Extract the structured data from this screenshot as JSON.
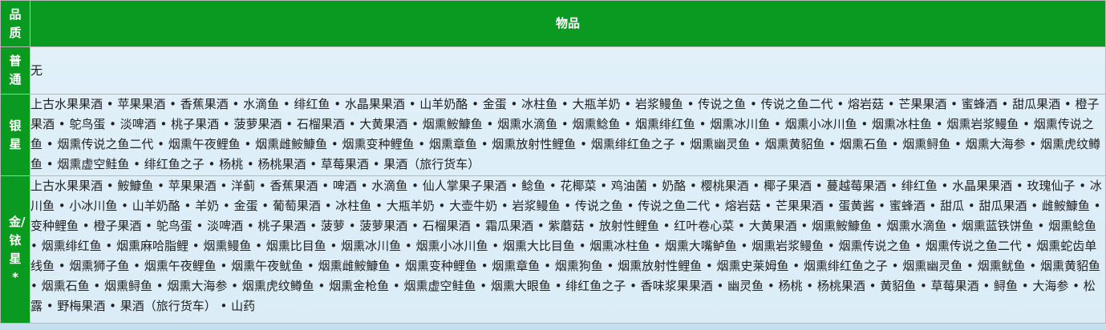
{
  "header": {
    "quality": "品质",
    "items": "物品"
  },
  "rows": [
    {
      "quality": "普通",
      "items": "无"
    },
    {
      "quality": "银星",
      "items": "上古水果果酒 • 苹果果酒 • 香蕉果酒 • 水滴鱼 • 绯红鱼 • 水晶果果酒 • 山羊奶酪 • 金蛋 • 冰柱鱼 • 大瓶羊奶 • 岩浆鳗鱼 • 传说之鱼 • 传说之鱼二代 • 熔岩菇 • 芒果果酒 • 蜜蜂酒 • 甜瓜果酒 • 橙子果酒 • 鸵鸟蛋 • 淡啤酒 • 桃子果酒 • 菠萝果酒 • 石榴果酒 • 大黄果酒 • 烟熏鮟鱇鱼 • 烟熏水滴鱼 • 烟熏鲶鱼 • 烟熏绯红鱼 • 烟熏冰川鱼 • 烟熏小冰川鱼 • 烟熏冰柱鱼 • 烟熏岩浆鳗鱼 • 烟熏传说之鱼 • 烟熏传说之鱼二代 • 烟熏午夜鲤鱼 • 烟熏雌鮟鱇鱼 • 烟熏变种鲤鱼 • 烟熏章鱼 • 烟熏放射性鲤鱼 • 烟熏绯红鱼之子 • 烟熏幽灵鱼 • 烟熏黄貂鱼 • 烟熏石鱼 • 烟熏鲟鱼 • 烟熏大海参 • 烟熏虎纹鳟鱼 • 烟熏虚空鲑鱼 • 绯红鱼之子 • 杨桃 • 杨桃果酒 • 草莓果酒 • 果酒（旅行货车）"
    },
    {
      "quality": "金/铱星*",
      "items": "上古水果果酒 • 鮟鱇鱼 • 苹果果酒 • 洋蓟 • 香蕉果酒 • 啤酒 • 水滴鱼 • 仙人掌果子果酒 • 鲶鱼 • 花椰菜 • 鸡油菌 • 奶酪 • 樱桃果酒 • 椰子果酒 • 蔓越莓果酒 • 绯红鱼 • 水晶果果酒 • 玫瑰仙子 • 冰川鱼 • 小冰川鱼 • 山羊奶酪 • 羊奶 • 金蛋 • 葡萄果酒 • 冰柱鱼 • 大瓶羊奶 • 大壶牛奶 • 岩浆鳗鱼 • 传说之鱼 • 传说之鱼二代 • 熔岩菇 • 芒果果酒 • 蛋黄酱 • 蜜蜂酒 • 甜瓜 • 甜瓜果酒 • 雌鮟鱇鱼 • 变种鲤鱼 • 橙子果酒 • 鸵鸟蛋 • 淡啤酒 • 桃子果酒 • 菠萝 • 菠萝果酒 • 石榴果酒 • 霜瓜果酒 • 紫蘑菇 • 放射性鲤鱼 • 红叶卷心菜 • 大黄果酒 • 烟熏鮟鱇鱼 • 烟熏水滴鱼 • 烟熏蓝铁饼鱼 • 烟熏鲶鱼 • 烟熏绯红鱼 • 烟熏麻哈脂鲤 • 烟熏鳗鱼 • 烟熏比目鱼 • 烟熏冰川鱼 • 烟熏小冰川鱼 • 烟熏大比目鱼 • 烟熏冰柱鱼 • 烟熏大嘴鲈鱼 • 烟熏岩浆鳗鱼 • 烟熏传说之鱼 • 烟熏传说之鱼二代 • 烟熏蛇齿单线鱼 • 烟熏狮子鱼 • 烟熏午夜鲤鱼 • 烟熏午夜鱿鱼 • 烟熏雌鮟鱇鱼 • 烟熏变种鲤鱼 • 烟熏章鱼 • 烟熏狗鱼 • 烟熏放射性鲤鱼 • 烟熏史莱姆鱼 • 烟熏绯红鱼之子 • 烟熏幽灵鱼 • 烟熏鱿鱼 • 烟熏黄貂鱼 • 烟熏石鱼 • 烟熏鲟鱼 • 烟熏大海参 • 烟熏虎纹鳟鱼 • 烟熏金枪鱼 • 烟熏虚空鲑鱼 • 烟熏大眼鱼 • 绯红鱼之子 • 香味浆果果酒 • 幽灵鱼 • 杨桃 • 杨桃果酒 • 黄貂鱼 • 草莓果酒 • 鲟鱼 • 大海参 • 松露 • 野梅果酒 • 果酒（旅行货车） • 山药"
    }
  ]
}
